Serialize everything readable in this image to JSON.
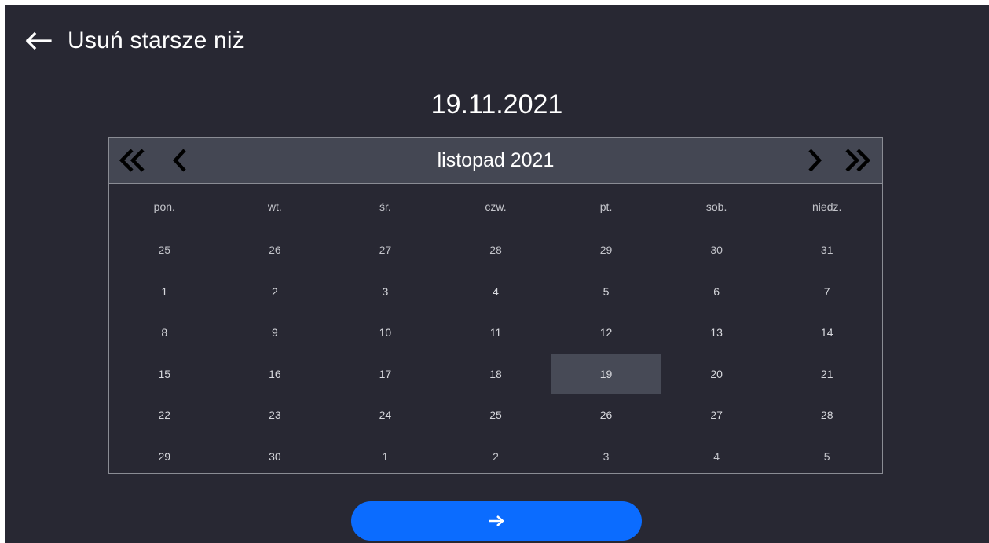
{
  "header": {
    "title": "Usuń starsze niż",
    "back_icon": "arrow-left-icon"
  },
  "selected_date": "19.11.2021",
  "calendar": {
    "month_label": "listopad 2021",
    "weekdays": [
      "pon.",
      "wt.",
      "śr.",
      "czw.",
      "pt.",
      "sob.",
      "niedz."
    ],
    "weeks": [
      [
        "25",
        "26",
        "27",
        "28",
        "29",
        "30",
        "31"
      ],
      [
        "1",
        "2",
        "3",
        "4",
        "5",
        "6",
        "7"
      ],
      [
        "8",
        "9",
        "10",
        "11",
        "12",
        "13",
        "14"
      ],
      [
        "15",
        "16",
        "17",
        "18",
        "19",
        "20",
        "21"
      ],
      [
        "22",
        "23",
        "24",
        "25",
        "26",
        "27",
        "28"
      ],
      [
        "29",
        "30",
        "1",
        "2",
        "3",
        "4",
        "5"
      ]
    ],
    "selected_day": "19",
    "nav_icons": [
      "double-chevron-left-icon",
      "chevron-left-icon",
      "chevron-right-icon",
      "double-chevron-right-icon"
    ]
  },
  "footer": {
    "next_icon": "arrow-right-icon"
  },
  "colors": {
    "background": "#282833",
    "header_bar": "#444753",
    "accent": "#0b6cff",
    "border": "#8a8c94"
  }
}
